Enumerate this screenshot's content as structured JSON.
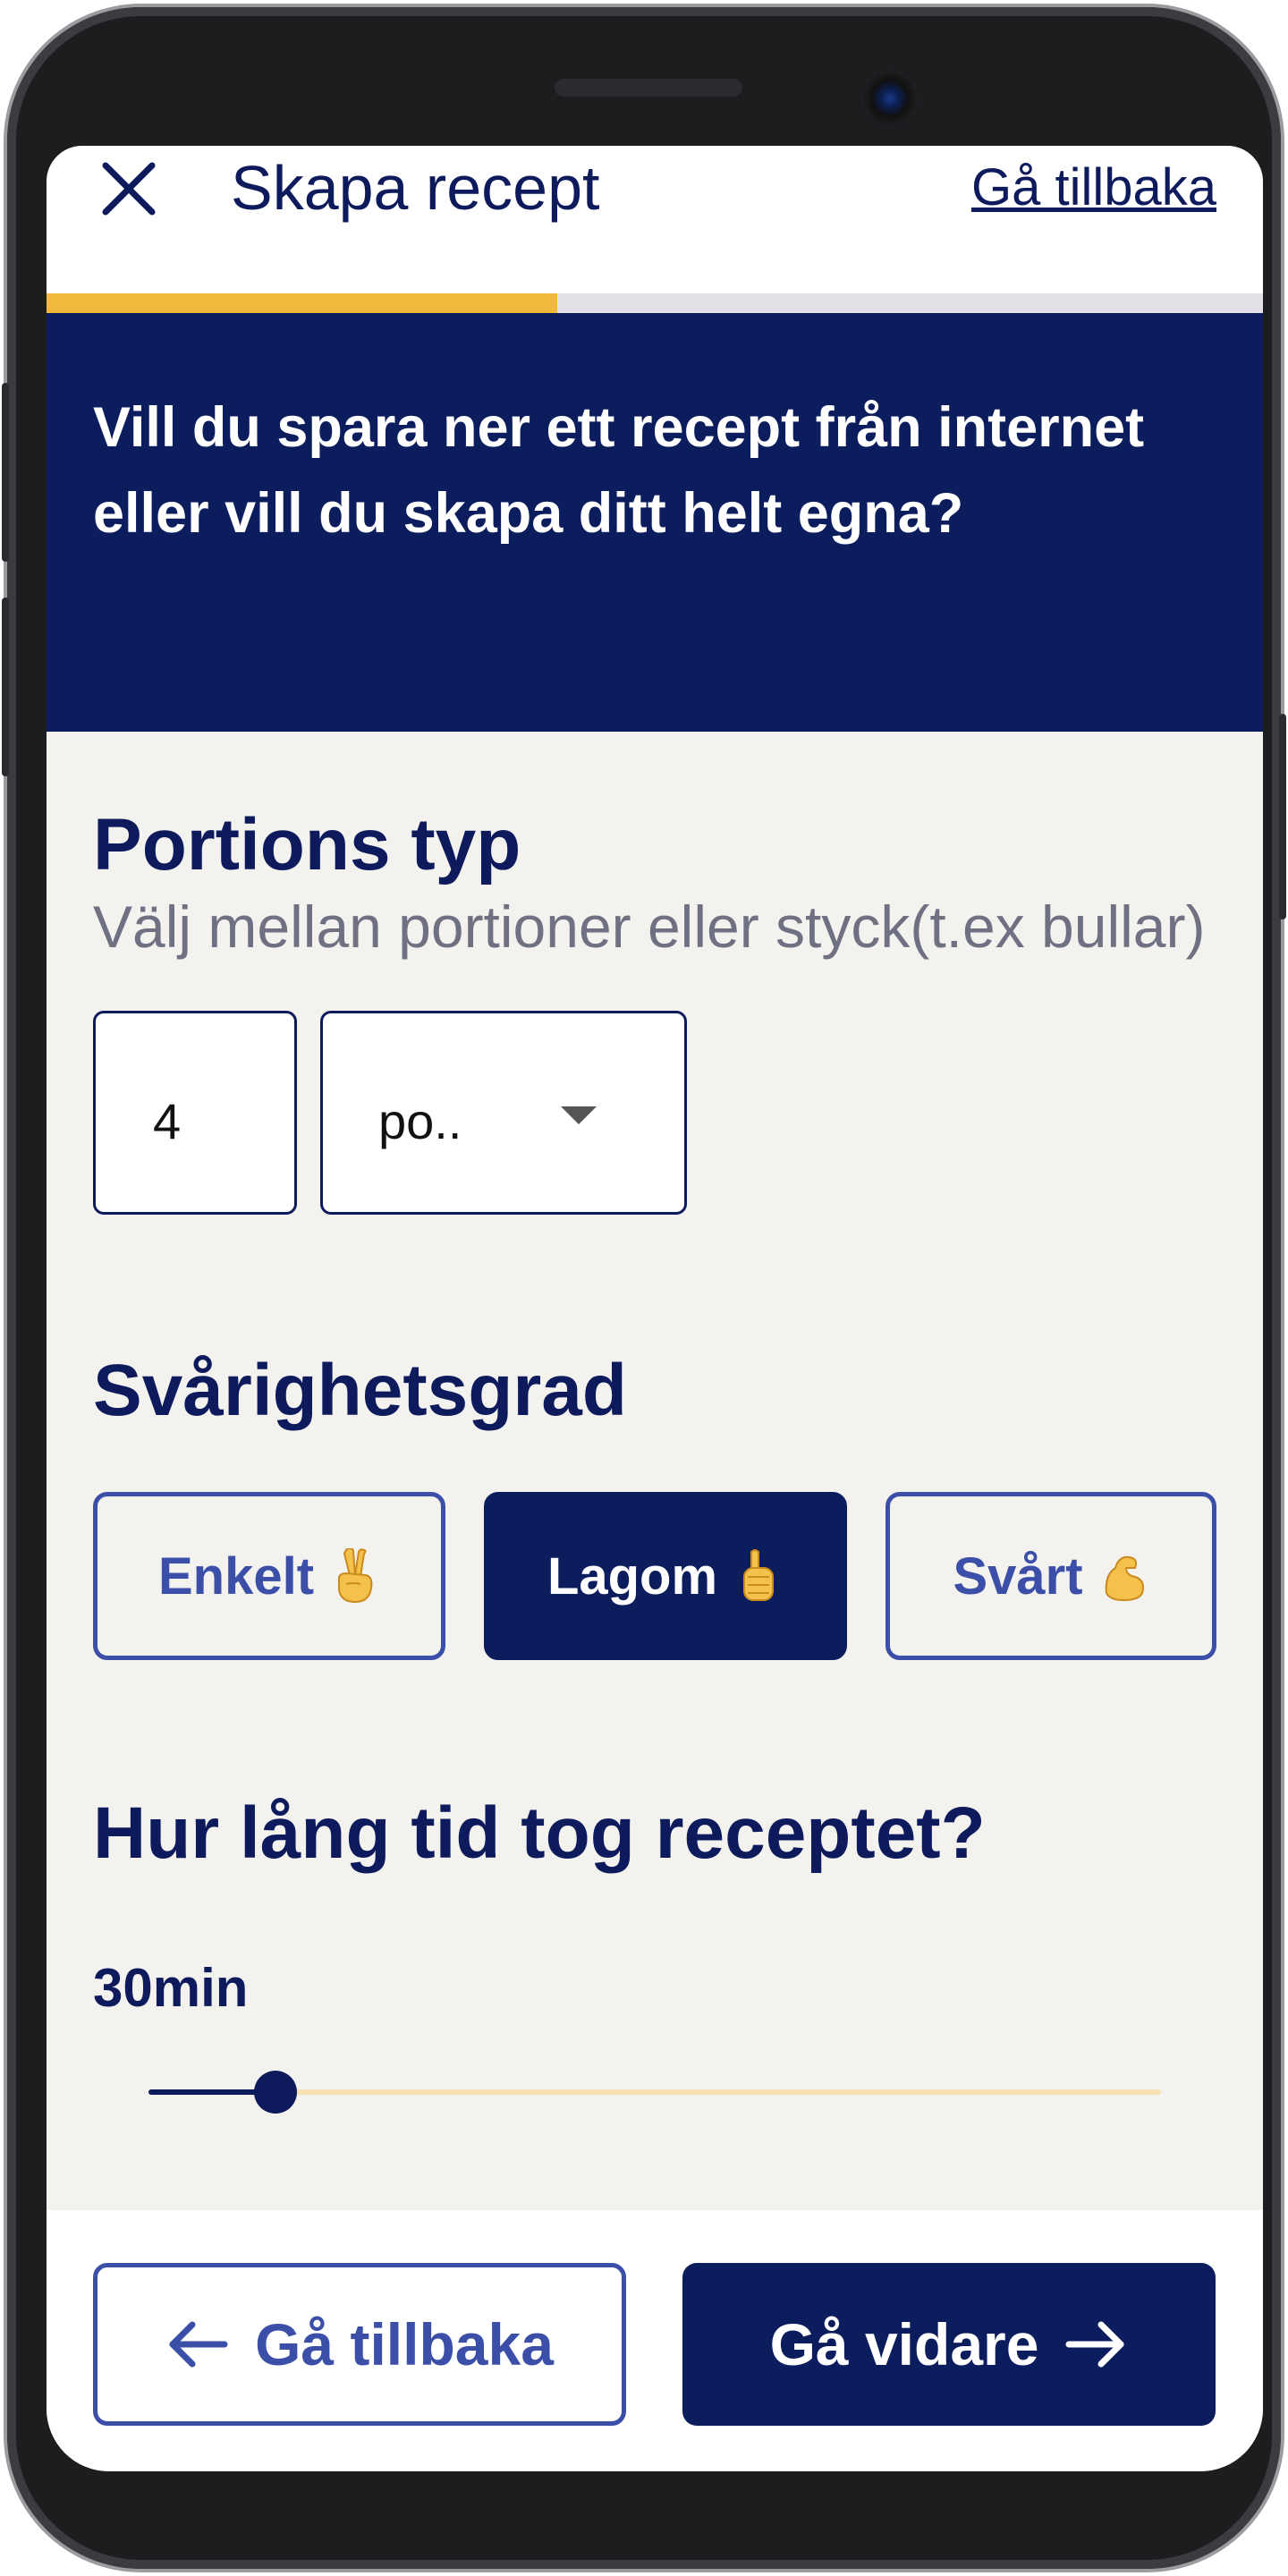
{
  "header": {
    "title": "Skapa recept",
    "back_link": "Gå tillbaka",
    "close_icon": "close-icon"
  },
  "progress": {
    "fraction": 0.42,
    "color": "#f1b83b"
  },
  "banner": {
    "text": "Vill du spara ner ett recept från internet eller vill du skapa ditt helt egna?"
  },
  "portions": {
    "heading": "Portions typ",
    "description": "Välj mellan portioner eller styck(t.ex bullar)",
    "quantity": "4",
    "unit_selected": "po.."
  },
  "difficulty": {
    "heading": "Svårighetsgrad",
    "options": [
      {
        "label": "Enkelt",
        "icon": "victory-hand-emoji",
        "selected": false
      },
      {
        "label": "Lagom",
        "icon": "thumbs-up-emoji",
        "selected": true
      },
      {
        "label": "Svårt",
        "icon": "flexed-biceps-emoji",
        "selected": false
      }
    ]
  },
  "time": {
    "heading": "Hur lång tid tog receptet?",
    "value": "30min",
    "slider_fraction": 0.125
  },
  "footer": {
    "back_label": "Gå tillbaka",
    "next_label": "Gå vidare"
  },
  "colors": {
    "navy": "#0c1d5e",
    "accent_blue": "#3b4fa8",
    "yellow": "#f1b83b",
    "background": "#f3f2ef"
  }
}
